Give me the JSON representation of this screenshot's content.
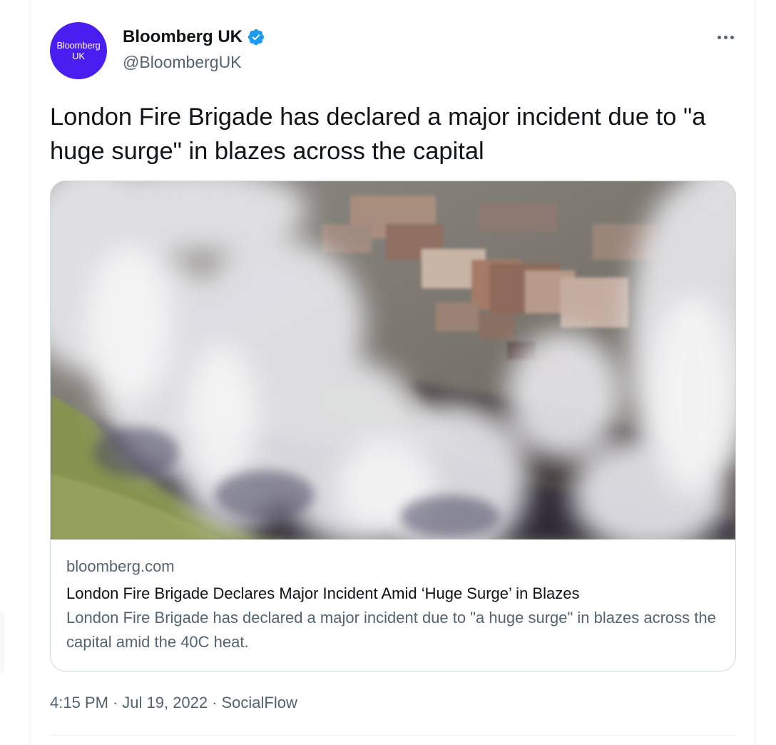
{
  "author": {
    "avatar_lines": [
      "Bloomberg",
      "UK"
    ],
    "display_name": "Bloomberg UK",
    "verified": true,
    "handle": "@BloombergUK",
    "avatar_color": "#4a1df0"
  },
  "tweet": {
    "text": "London Fire Brigade has declared a major incident due to \"a huge surge\" in blazes across the capital",
    "time": "4:15 PM",
    "date": "Jul 19, 2022",
    "source": "SocialFlow",
    "separator": "·"
  },
  "card": {
    "domain": "bloomberg.com",
    "title": "London Fire Brigade Declares Major Incident Amid ‘Huge Surge’ in Blazes",
    "description": "London Fire Brigade has declared a major incident due to \"a huge surge\" in blazes across the capital amid the 40C heat."
  },
  "icons": {
    "more": "more-horizontal-icon",
    "verified": "verified-badge-icon"
  },
  "colors": {
    "text_primary": "#0f1419",
    "text_secondary": "#536471",
    "border": "#cfd9de",
    "verified_blue": "#1d9bf0"
  }
}
